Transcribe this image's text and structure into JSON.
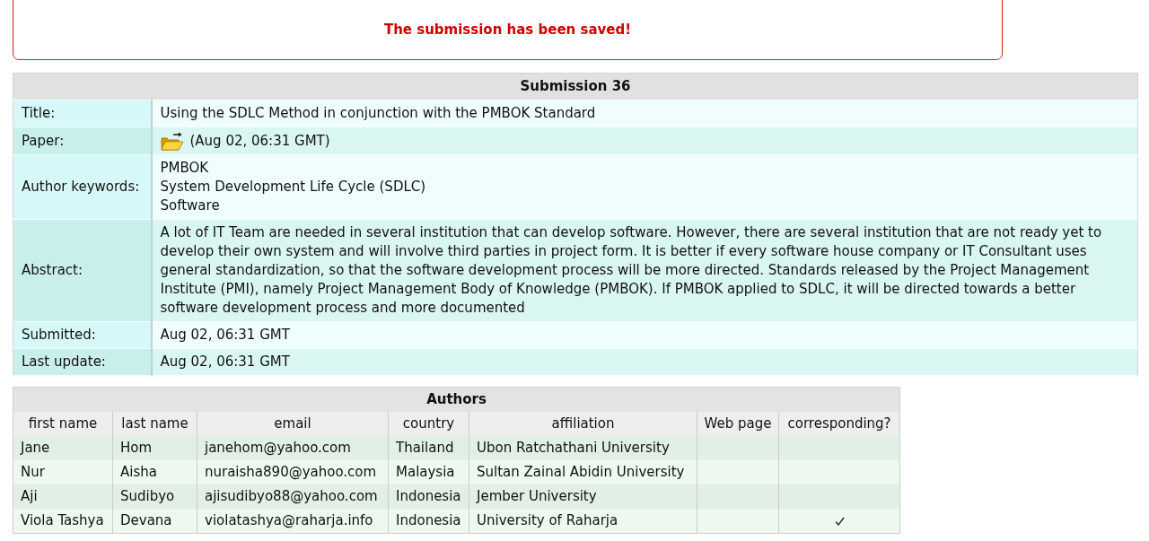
{
  "message": "The submission has been saved!",
  "submission": {
    "title": "Submission 36",
    "rows": [
      {
        "kind": "text",
        "label": "Title:",
        "value": "Using the SDLC Method in conjunction with the PMBOK Standard"
      },
      {
        "kind": "file",
        "label": "Paper:",
        "value": "(Aug 02, 06:31 GMT)"
      },
      {
        "kind": "list",
        "label": "Author keywords:",
        "items": [
          "PMBOK",
          "System Development Life Cycle (SDLC)",
          "Software"
        ]
      },
      {
        "kind": "text",
        "label": "Abstract:",
        "value": "A lot of IT Team are needed in several institution that can develop software. However, there are several institution that are not ready yet to develop their own system and will involve third parties in project form. It is better if every software house company or IT Consultant uses general standardization, so that the software development process will be more directed. Standards released by the Project Management Institute (PMI), namely Project Management Body of Knowledge (PMBOK). If PMBOK applied to SDLC, it will be directed towards a better software development process and more documented"
      },
      {
        "kind": "text",
        "label": "Submitted:",
        "value": "Aug 02, 06:31 GMT"
      },
      {
        "kind": "text",
        "label": "Last update:",
        "value": "Aug 02, 06:31 GMT"
      }
    ]
  },
  "authors": {
    "title": "Authors",
    "columns": [
      "first name",
      "last name",
      "email",
      "country",
      "affiliation",
      "Web page",
      "corresponding?"
    ],
    "rows": [
      {
        "first_name": "Jane",
        "last_name": "Hom",
        "email": "janehom@yahoo.com",
        "country": "Thailand",
        "affiliation": "Ubon Ratchathani University",
        "corresponding": false
      },
      {
        "first_name": "Nur",
        "last_name": "Aisha",
        "email": "nuraisha890@yahoo.com",
        "country": "Malaysia",
        "affiliation": "Sultan Zainal Abidin University",
        "corresponding": false
      },
      {
        "first_name": "Aji",
        "last_name": "Sudibyo",
        "email": "ajisudibyo88@yahoo.com",
        "country": "Indonesia",
        "affiliation": "Jember University",
        "corresponding": false
      },
      {
        "first_name": "Viola Tashya",
        "last_name": "Devana",
        "email": "violatashya@raharja.info",
        "country": "Indonesia",
        "affiliation": "University of Raharja",
        "corresponding": true
      }
    ]
  }
}
